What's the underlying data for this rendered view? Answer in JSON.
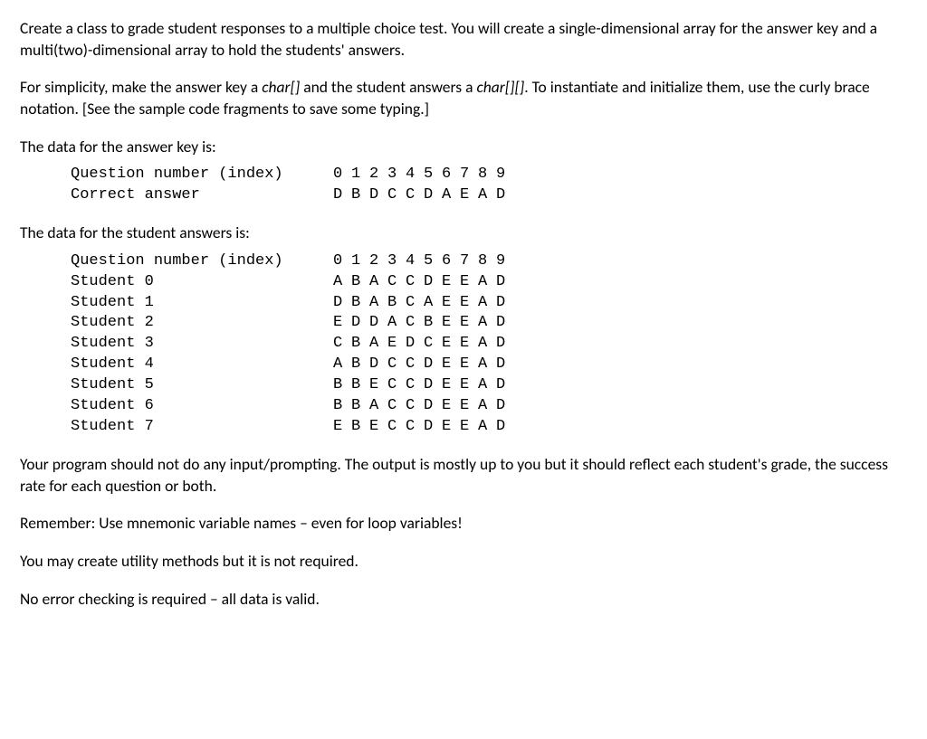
{
  "paragraphs": {
    "p1a": "Create a class to grade student responses to a multiple choice test.  You will create a single-dimensional array for the answer key and a multi(two)-dimensional array to hold the students' answers.",
    "p2_prefix": "For simplicity, make the answer key a ",
    "p2_char1": "char[]",
    "p2_mid": " and the student answers a ",
    "p2_char2": "char[][]",
    "p2_suffix": ".  To instantiate and initialize them, use the curly brace notation.  [See the sample code fragments to save some typing.]",
    "p3": "The data for the answer key is:",
    "p4": "The data for the student answers is:",
    "p5": "Your program should not do any input/prompting.  The output is mostly up to you but it should reflect each student's grade, the success rate for each question or both.",
    "p6": "Remember: Use mnemonic variable names – even for loop variables!",
    "p7": "You may create utility methods but it is not required.",
    "p8": "No error checking is required – all data is valid."
  },
  "answerKey": {
    "rows": [
      {
        "label": "Question number (index)",
        "values": [
          "0",
          "1",
          "2",
          "3",
          "4",
          "5",
          "6",
          "7",
          "8",
          "9"
        ]
      },
      {
        "label": "Correct answer",
        "values": [
          "D",
          "B",
          "D",
          "C",
          "C",
          "D",
          "A",
          "E",
          "A",
          "D"
        ]
      }
    ]
  },
  "studentAnswers": {
    "rows": [
      {
        "label": "Question number (index)",
        "values": [
          "0",
          "1",
          "2",
          "3",
          "4",
          "5",
          "6",
          "7",
          "8",
          "9"
        ]
      },
      {
        "label": "Student 0",
        "values": [
          "A",
          "B",
          "A",
          "C",
          "C",
          "D",
          "E",
          "E",
          "A",
          "D"
        ]
      },
      {
        "label": "Student 1",
        "values": [
          "D",
          "B",
          "A",
          "B",
          "C",
          "A",
          "E",
          "E",
          "A",
          "D"
        ]
      },
      {
        "label": "Student 2",
        "values": [
          "E",
          "D",
          "D",
          "A",
          "C",
          "B",
          "E",
          "E",
          "A",
          "D"
        ]
      },
      {
        "label": "Student 3",
        "values": [
          "C",
          "B",
          "A",
          "E",
          "D",
          "C",
          "E",
          "E",
          "A",
          "D"
        ]
      },
      {
        "label": "Student 4",
        "values": [
          "A",
          "B",
          "D",
          "C",
          "C",
          "D",
          "E",
          "E",
          "A",
          "D"
        ]
      },
      {
        "label": "Student 5",
        "values": [
          "B",
          "B",
          "E",
          "C",
          "C",
          "D",
          "E",
          "E",
          "A",
          "D"
        ]
      },
      {
        "label": "Student 6",
        "values": [
          "B",
          "B",
          "A",
          "C",
          "C",
          "D",
          "E",
          "E",
          "A",
          "D"
        ]
      },
      {
        "label": "Student 7",
        "values": [
          "E",
          "B",
          "E",
          "C",
          "C",
          "D",
          "E",
          "E",
          "A",
          "D"
        ]
      }
    ]
  }
}
